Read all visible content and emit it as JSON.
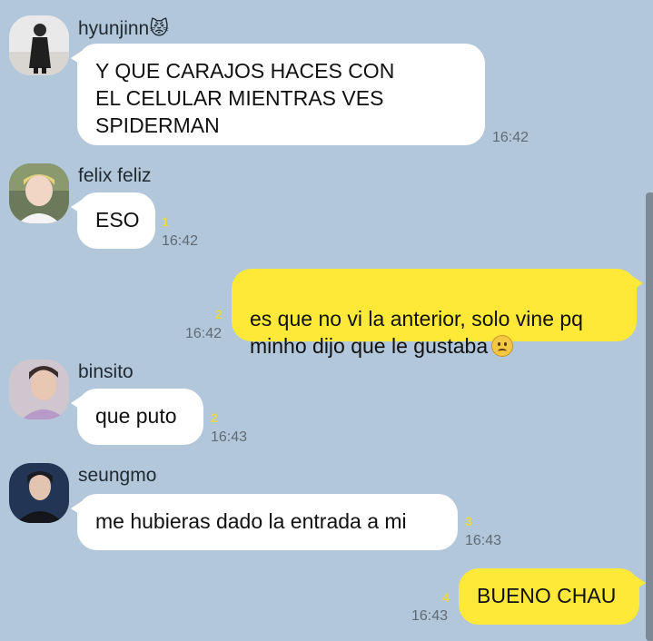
{
  "messages": [
    {
      "sender": "hyunjinn",
      "sender_emoji": "😾",
      "text": "Y QUE CARAJOS HACES CON\nEL CELULAR MIENTRAS VES\nSPIDERMAN",
      "time": "16:42",
      "unread": ""
    },
    {
      "sender": "felix feliz",
      "text": "ESO",
      "time": "16:42",
      "unread": "1"
    },
    {
      "sender": "me",
      "text": "es que no vi la anterior, solo vine pq\nminho dijo que le gustaba",
      "emoji": "frowning-face",
      "time": "16:42",
      "unread": "2"
    },
    {
      "sender": "binsito",
      "text": "que puto",
      "time": "16:43",
      "unread": "2"
    },
    {
      "sender": "seungmo",
      "text": "me hubieras dado la entrada a mi",
      "time": "16:43",
      "unread": "3"
    },
    {
      "sender": "me",
      "text": "BUENO CHAU",
      "time": "16:43",
      "unread": "4"
    }
  ],
  "colors": {
    "background": "#b2c7d9",
    "incoming_bubble": "#ffffff",
    "outgoing_bubble": "#fee838",
    "unread_count": "#e8d84a",
    "timestamp": "#5e6b76"
  }
}
